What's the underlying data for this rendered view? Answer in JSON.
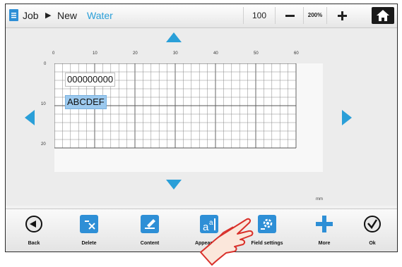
{
  "header": {
    "crumbs": [
      "Job",
      "New",
      "Water"
    ],
    "zoom_value": "100",
    "zoom_percent": "200%"
  },
  "ruler": {
    "x_ticks": [
      "0",
      "10",
      "20",
      "30",
      "40",
      "50",
      "60"
    ],
    "y_ticks": [
      "0",
      "10",
      "20"
    ],
    "unit": "mm"
  },
  "fields": {
    "field1_text": "000000000",
    "field2_text": "ABCDEF"
  },
  "toolbar": {
    "back": "Back",
    "delete": "Delete",
    "content": "Content",
    "appearance": "Appearance",
    "field_settings": "Field settings",
    "more": "More",
    "ok": "Ok"
  },
  "colors": {
    "accent": "#2e8fd6",
    "selected_field": "#9cc9ee",
    "hand_outline": "#d9302a"
  }
}
